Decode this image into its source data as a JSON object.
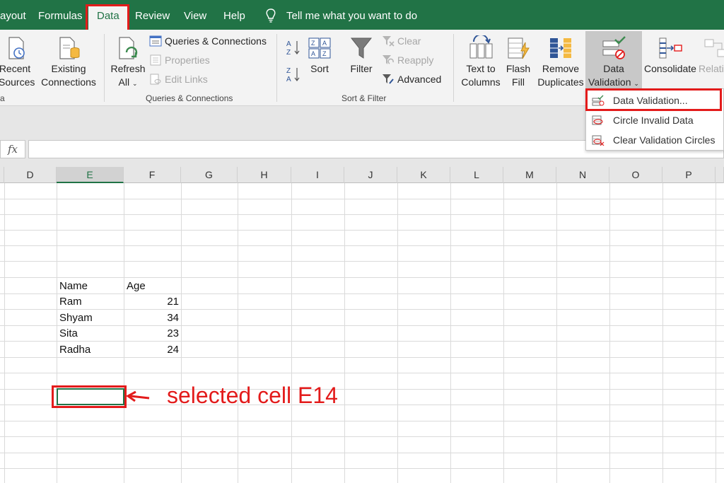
{
  "menubar": {
    "tabs": [
      "ayout",
      "Formulas",
      "Data",
      "Review",
      "View",
      "Help"
    ],
    "active_tab": "Data",
    "tell_me": "Tell me what you want to do"
  },
  "ribbon": {
    "get_data": {
      "recent_sources": [
        "Recent",
        "Sources"
      ],
      "existing_connections": [
        "Existing",
        "Connections"
      ],
      "group_label": "a"
    },
    "queries": {
      "refresh_all": [
        "Refresh",
        "All"
      ],
      "queries_connections": "Queries & Connections",
      "properties": "Properties",
      "edit_links": "Edit Links",
      "group_label": "Queries & Connections"
    },
    "sort_filter": {
      "sort": "Sort",
      "filter": "Filter",
      "clear": "Clear",
      "reapply": "Reapply",
      "advanced": "Advanced",
      "group_label": "Sort & Filter"
    },
    "data_tools": {
      "text_to_columns": [
        "Text to",
        "Columns"
      ],
      "flash_fill": [
        "Flash",
        "Fill"
      ],
      "remove_duplicates": [
        "Remove",
        "Duplicates"
      ],
      "data_validation": [
        "Data",
        "Validation"
      ],
      "consolidate": "Consolidate",
      "relationships": "Relati"
    }
  },
  "dropdown": {
    "items": [
      "Data Validation...",
      "Circle Invalid Data",
      "Clear Validation Circles"
    ]
  },
  "formula_bar": {
    "fx": "fx",
    "value": ""
  },
  "columns": [
    "D",
    "E",
    "F",
    "G",
    "H",
    "I",
    "J",
    "K",
    "L",
    "M",
    "N",
    "O",
    "P"
  ],
  "selected_column": "E",
  "table": {
    "headers": [
      "Name",
      "Age"
    ],
    "rows": [
      {
        "name": "Ram",
        "age": "21"
      },
      {
        "name": "Shyam",
        "age": "34"
      },
      {
        "name": "Sita",
        "age": "23"
      },
      {
        "name": "Radha",
        "age": "24"
      }
    ]
  },
  "annotation": "selected cell E14",
  "colors": {
    "excel_green": "#217346",
    "annotation_red": "#e31b1b"
  }
}
